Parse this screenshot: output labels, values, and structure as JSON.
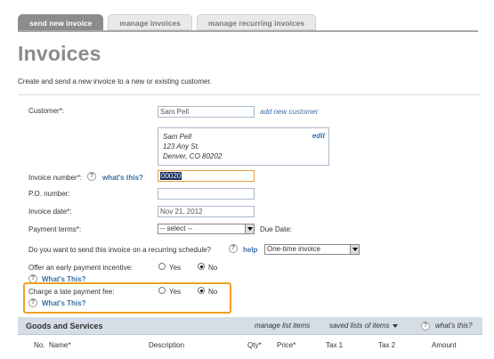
{
  "tabs": [
    {
      "label": "send new invoice",
      "active": true
    },
    {
      "label": "manage invoices",
      "active": false
    },
    {
      "label": "manage recurring invoices",
      "active": false
    }
  ],
  "page": {
    "title": "Invoices",
    "subtitle": "Create and send a new invoice to a new or existing customer."
  },
  "customer": {
    "label": "Customer*:",
    "value": "Sam Pell",
    "add_link": "add new customer",
    "address": [
      "Sam Pell",
      "123 Any St.",
      "Denver, CO 80202"
    ],
    "edit_link": "edit"
  },
  "invoice_number": {
    "label": "Invoice number*:",
    "help_link": "what's this?",
    "value": "00020"
  },
  "po_number": {
    "label": "P.O. number:",
    "value": ""
  },
  "invoice_date": {
    "label": "Invoice date*:",
    "value": "Nov 21, 2012"
  },
  "payment_terms": {
    "label": "Payment terms*:",
    "selected": "-- select --",
    "due_label": "Due Date:"
  },
  "recurring": {
    "label": "Do you want to send this invoice on a recurring schedule?",
    "help_link": "help",
    "selected": "One-time invoice"
  },
  "early_payment": {
    "label": "Offer an early payment incentive:",
    "yes": "Yes",
    "no": "No",
    "selected": "No",
    "whats_this": "What's This?"
  },
  "late_fee": {
    "label": "Charge a late payment fee:",
    "yes": "Yes",
    "no": "No",
    "selected": "No",
    "whats_this": "What's This?"
  },
  "goods": {
    "title": "Goods and Services",
    "manage_link": "manage list items",
    "saved_link": "saved lists of items",
    "whats_this": "what's this?",
    "columns": [
      "No.",
      "Name*",
      "Description",
      "Qty*",
      "Price*",
      "Tax 1",
      "Tax 2",
      "Amount"
    ]
  },
  "colors": {
    "accent_orange": "#f0a020",
    "link_blue": "#3b6ea5",
    "tab_active": "#8c8c8c",
    "goods_header": "#d5dde6"
  },
  "icons": [
    "help-circle-icon",
    "dropdown-arrow-icon",
    "radio-button-icon",
    "caret-down-icon"
  ]
}
